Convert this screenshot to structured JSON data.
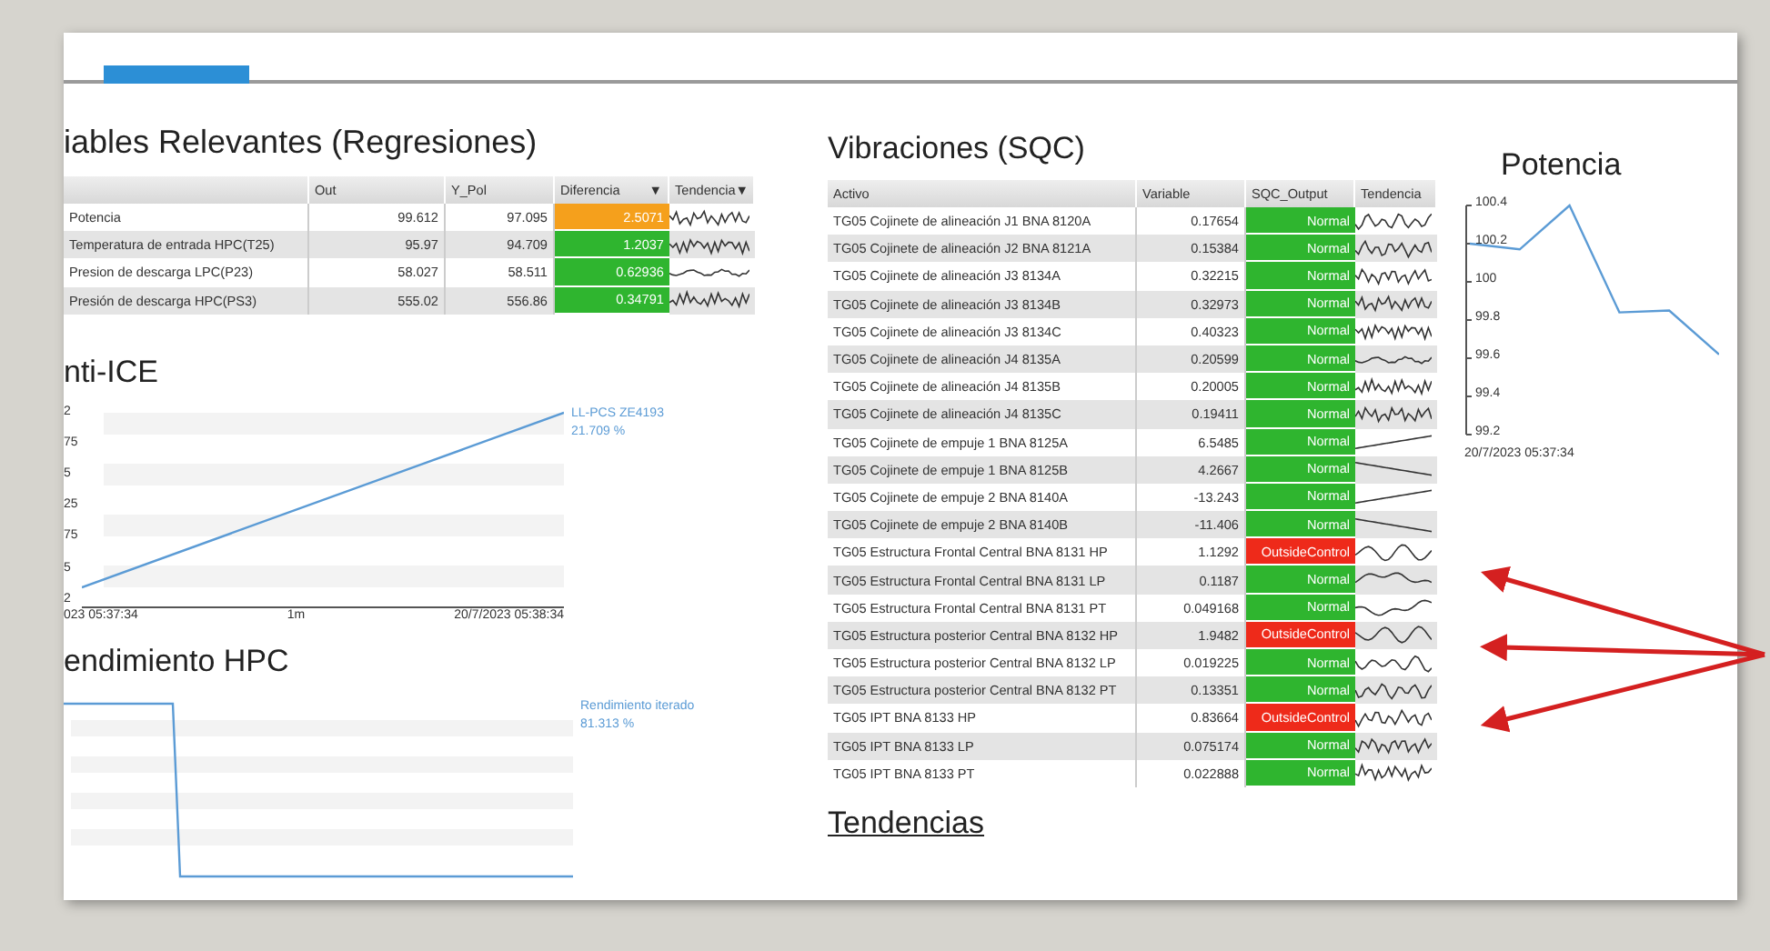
{
  "regresiones": {
    "title": "iables Relevantes (Regresiones)",
    "columns": [
      "Out",
      "Y_Pol",
      "Diferencia",
      "Tendencia"
    ],
    "sort_marks": [
      "▼",
      "▼"
    ],
    "rows": [
      {
        "name": "Potencia",
        "out": "99.612",
        "y_pol": "97.095",
        "diferencia": "2.5071",
        "color": "#f5a01c"
      },
      {
        "name": "Temperatura de entrada HPC(T25)",
        "out": "95.97",
        "y_pol": "94.709",
        "diferencia": "1.2037",
        "color": "#2fb52f"
      },
      {
        "name": "Presion de descarga LPC(P23)",
        "out": "58.027",
        "y_pol": "58.511",
        "diferencia": "0.62936",
        "color": "#2fb52f"
      },
      {
        "name": "Presión de descarga HPC(PS3)",
        "out": "555.02",
        "y_pol": "556.86",
        "diferencia": "0.34791",
        "color": "#2fb52f"
      }
    ]
  },
  "anti_ice": {
    "title": "nti-ICE",
    "y_tick_labels": [
      "2",
      "75",
      "5",
      "25",
      "75",
      "5",
      "2"
    ],
    "x_tick_labels": [
      "023 05:37:34",
      "1m",
      "20/7/2023 05:38:34"
    ],
    "legend_name": "LL-PCS ZE4193",
    "legend_value": "21.709 %"
  },
  "rendimiento": {
    "title": "endimiento HPC",
    "legend_name": "Rendimiento iterado",
    "legend_value": "81.313 %"
  },
  "vibraciones": {
    "title": "Vibraciones (SQC)",
    "columns": [
      "Activo",
      "Variable",
      "SQC_Output",
      "Tendencia"
    ],
    "rows": [
      {
        "activo": "TG05 Cojinete de alineación J1 BNA 8120A",
        "variable": "0.17654",
        "output": "Normal",
        "color": "#2fb52f"
      },
      {
        "activo": "TG05 Cojinete de alineación J2 BNA 8121A",
        "variable": "0.15384",
        "output": "Normal",
        "color": "#2fb52f"
      },
      {
        "activo": "TG05 Cojinete de alineación J3 8134A",
        "variable": "0.32215",
        "output": "Normal",
        "color": "#2fb52f"
      },
      {
        "activo": "TG05 Cojinete de alineación J3 8134B",
        "variable": "0.32973",
        "output": "Normal",
        "color": "#2fb52f"
      },
      {
        "activo": "TG05 Cojinete de alineación J3 8134C",
        "variable": "0.40323",
        "output": "Normal",
        "color": "#2fb52f"
      },
      {
        "activo": "TG05 Cojinete de alineación J4 8135A",
        "variable": "0.20599",
        "output": "Normal",
        "color": "#2fb52f"
      },
      {
        "activo": "TG05 Cojinete de alineación J4 8135B",
        "variable": "0.20005",
        "output": "Normal",
        "color": "#2fb52f"
      },
      {
        "activo": "TG05 Cojinete de alineación J4 8135C",
        "variable": "0.19411",
        "output": "Normal",
        "color": "#2fb52f"
      },
      {
        "activo": "TG05 Cojinete de empuje 1 BNA 8125A",
        "variable": "6.5485",
        "output": "Normal",
        "color": "#2fb52f"
      },
      {
        "activo": "TG05 Cojinete de empuje 1 BNA 8125B",
        "variable": "4.2667",
        "output": "Normal",
        "color": "#2fb52f"
      },
      {
        "activo": "TG05 Cojinete de empuje 2 BNA 8140A",
        "variable": "-13.243",
        "output": "Normal",
        "color": "#2fb52f"
      },
      {
        "activo": "TG05 Cojinete de empuje 2 BNA 8140B",
        "variable": "-11.406",
        "output": "Normal",
        "color": "#2fb52f"
      },
      {
        "activo": "TG05 Estructura Frontal Central BNA 8131 HP",
        "variable": "1.1292",
        "output": "OutsideControl",
        "color": "#ee2a1a"
      },
      {
        "activo": "TG05 Estructura Frontal Central BNA 8131 LP",
        "variable": "0.1187",
        "output": "Normal",
        "color": "#2fb52f"
      },
      {
        "activo": "TG05 Estructura Frontal Central BNA 8131 PT",
        "variable": "0.049168",
        "output": "Normal",
        "color": "#2fb52f"
      },
      {
        "activo": "TG05 Estructura posterior Central BNA 8132 HP",
        "variable": "1.9482",
        "output": "OutsideControl",
        "color": "#ee2a1a"
      },
      {
        "activo": "TG05 Estructura posterior Central BNA 8132 LP",
        "variable": "0.019225",
        "output": "Normal",
        "color": "#2fb52f"
      },
      {
        "activo": "TG05 Estructura posterior Central BNA 8132 PT",
        "variable": "0.13351",
        "output": "Normal",
        "color": "#2fb52f"
      },
      {
        "activo": "TG05 IPT BNA 8133 HP",
        "variable": "0.83664",
        "output": "OutsideControl",
        "color": "#ee2a1a"
      },
      {
        "activo": "TG05 IPT BNA 8133 LP",
        "variable": "0.075174",
        "output": "Normal",
        "color": "#2fb52f"
      },
      {
        "activo": "TG05 IPT BNA 8133 PT",
        "variable": "0.022888",
        "output": "Normal",
        "color": "#2fb52f"
      }
    ]
  },
  "tendencias_link": "Tendencias",
  "potencia": {
    "title": "Potencia",
    "chart_data": {
      "type": "line",
      "ylim": [
        99.2,
        100.4
      ],
      "yticks": [
        {
          "value": 100.4,
          "label": "100.4"
        },
        {
          "value": 100.2,
          "label": "100.2"
        },
        {
          "value": 100,
          "label": "100"
        },
        {
          "value": 99.8,
          "label": "99.8"
        },
        {
          "value": 99.6,
          "label": "99.6"
        },
        {
          "value": 99.4,
          "label": "99.4"
        },
        {
          "value": 99.2,
          "label": "99.2"
        }
      ],
      "series": [
        {
          "color": "#5b9bd5",
          "values": [
            100.2,
            100.17,
            100.4,
            99.84,
            99.85,
            99.62
          ]
        }
      ]
    },
    "x_start_label": "20/7/2023 05:37:34"
  }
}
